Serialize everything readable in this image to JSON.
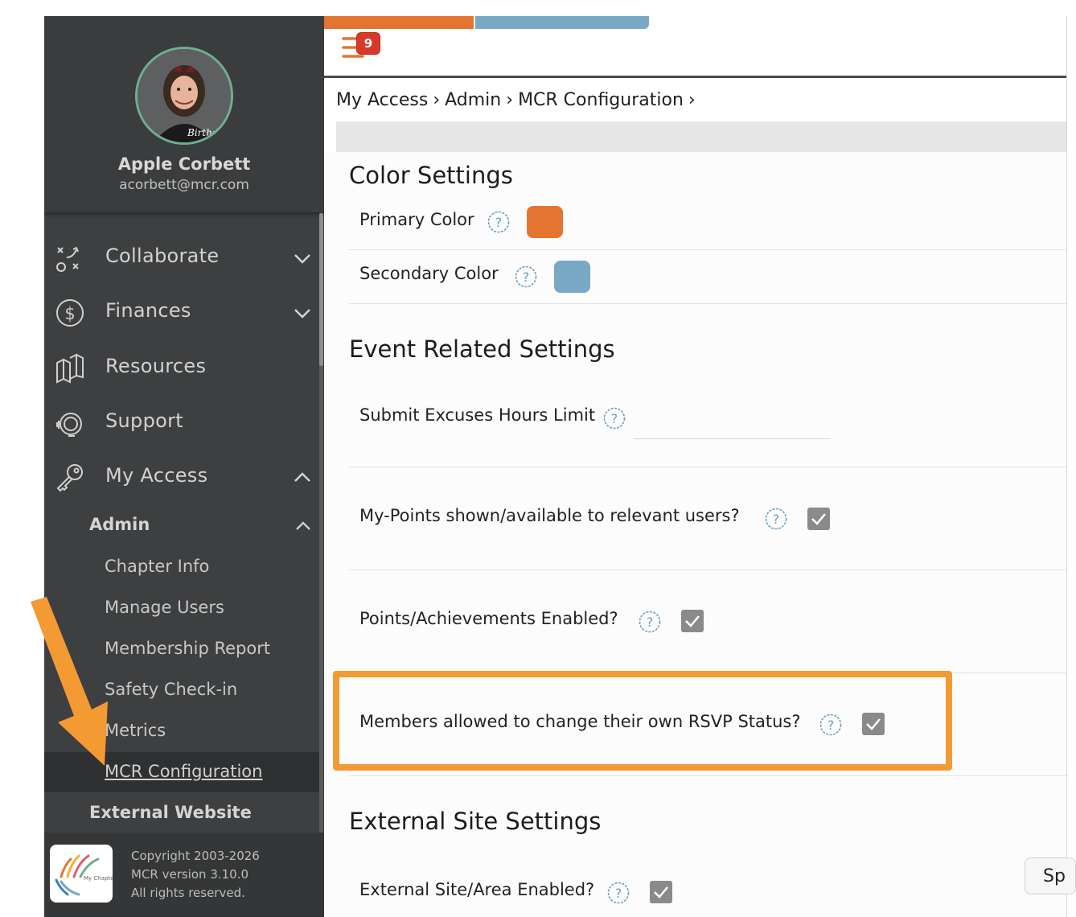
{
  "profile": {
    "name": "Apple Corbett",
    "email": "acorbett@mcr.com",
    "avatar_caption": "Birthday"
  },
  "sidebar": {
    "items": [
      {
        "label": "Collaborate",
        "icon": "collaborate-plays-icon",
        "expanded": false
      },
      {
        "label": "Finances",
        "icon": "dollar-circle-icon",
        "expanded": false
      },
      {
        "label": "Resources",
        "icon": "books-icon"
      },
      {
        "label": "Support",
        "icon": "headset-icon"
      },
      {
        "label": "My Access",
        "icon": "key-icon",
        "expanded": true
      }
    ],
    "admin": {
      "label": "Admin",
      "expanded": true,
      "items": [
        "Chapter Info",
        "Manage Users",
        "Membership Report",
        "Safety Check-in",
        "Metrics",
        "MCR Configuration"
      ],
      "active": "MCR Configuration"
    },
    "external_website": "External Website"
  },
  "footer": {
    "copyright": "Copyright 2003-2026",
    "version": "MCR version 3.10.0",
    "rights": "All rights reserved.",
    "logo_text": "My Chapter Room"
  },
  "topbar": {
    "notification_count": "9",
    "accent_colors": [
      "#e37530",
      "#79a8c4"
    ]
  },
  "breadcrumb": [
    "My Access",
    "Admin",
    "MCR Configuration"
  ],
  "color_settings": {
    "title": "Color Settings",
    "primary_label": "Primary Color",
    "primary_color": "#e37530",
    "secondary_label": "Secondary Color",
    "secondary_color": "#79a8c4"
  },
  "event_settings": {
    "title": "Event Related Settings",
    "excuses_label": "Submit Excuses Hours Limit",
    "excuses_value": "",
    "mypoints_label": "My-Points shown/available to relevant users?",
    "mypoints_checked": true,
    "achievements_label": "Points/Achievements Enabled?",
    "achievements_checked": true,
    "rsvp_label": "Members allowed to change their own RSVP Status?",
    "rsvp_checked": true
  },
  "external_settings": {
    "title": "External Site Settings",
    "site_label": "External Site/Area Enabled?",
    "site_checked": true
  },
  "floating_button": "Sp"
}
